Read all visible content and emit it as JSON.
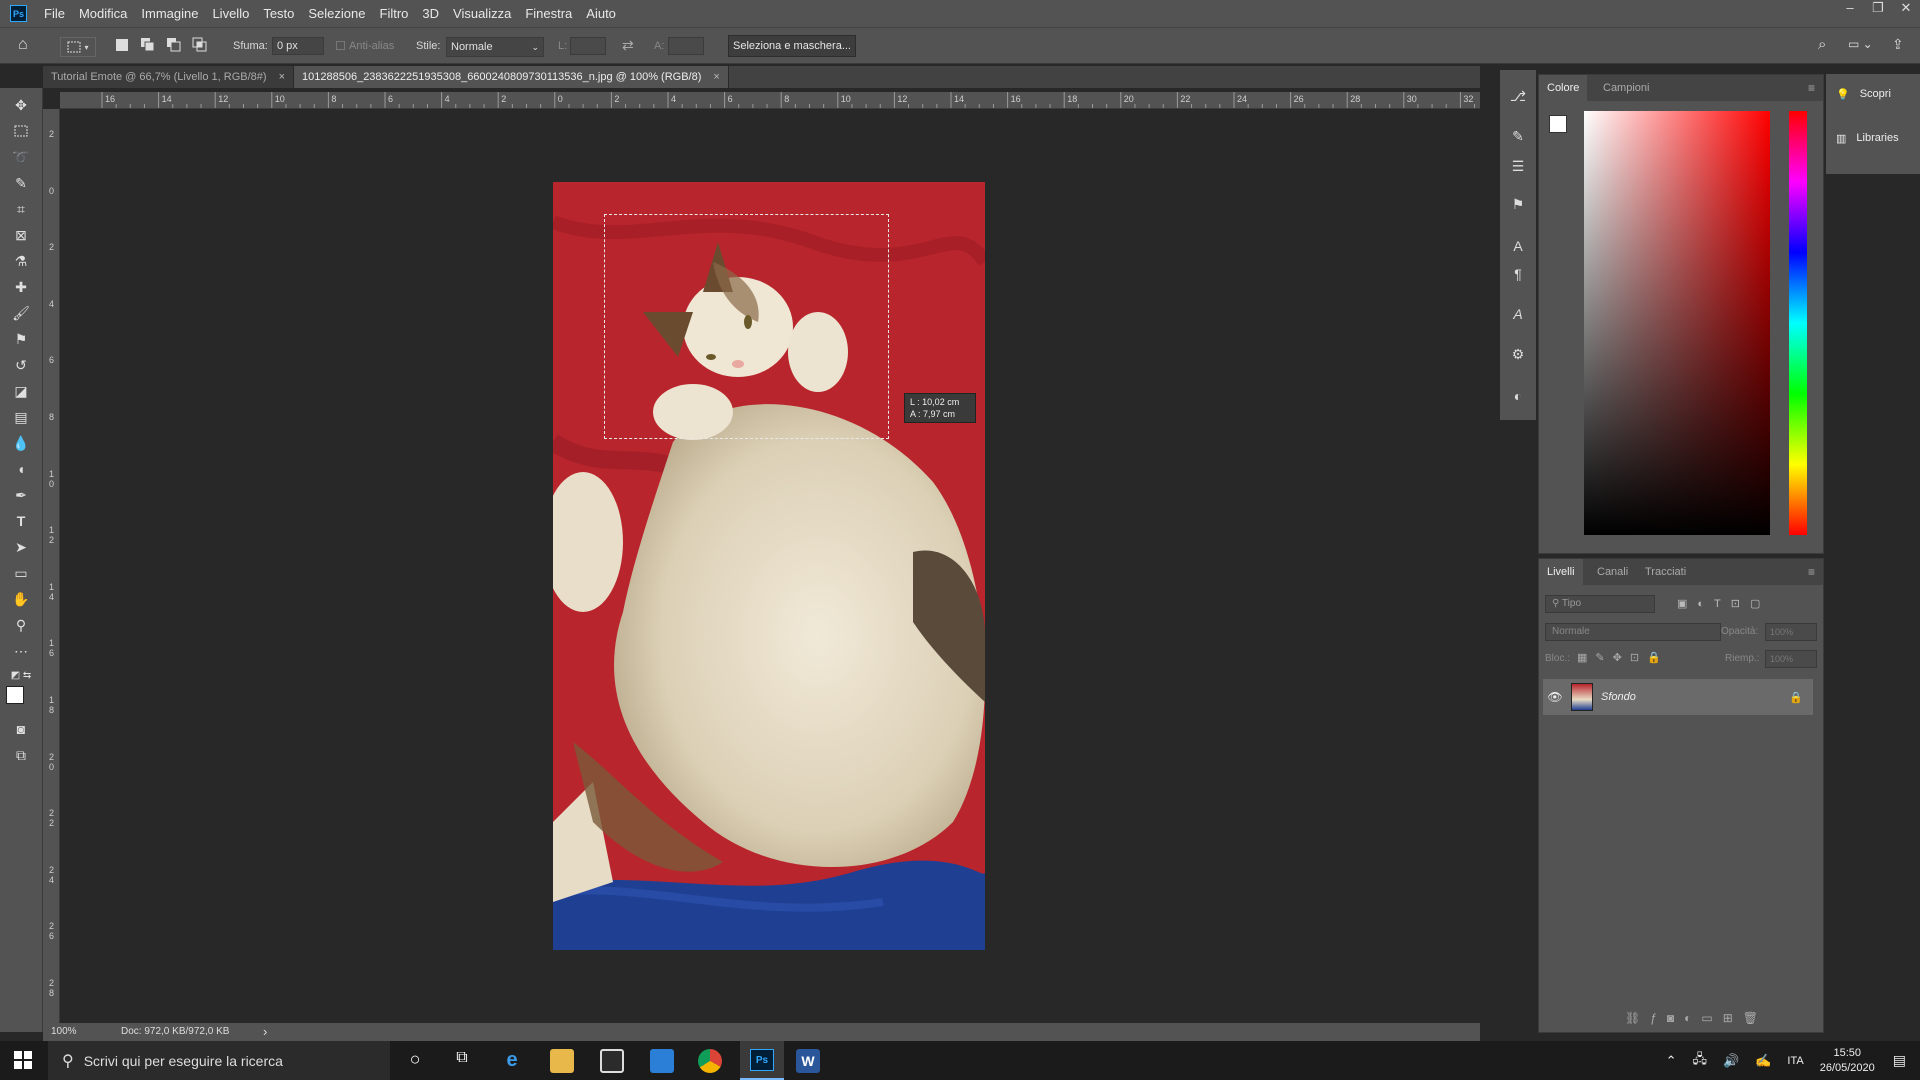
{
  "app": {
    "logo": "Ps"
  },
  "menu": [
    "File",
    "Modifica",
    "Immagine",
    "Livello",
    "Testo",
    "Selezione",
    "Filtro",
    "3D",
    "Visualizza",
    "Finestra",
    "Aiuto"
  ],
  "options": {
    "feather_label": "Sfuma:",
    "feather_value": "0 px",
    "antialias_label": "Anti-alias",
    "style_label": "Stile:",
    "style_value": "Normale",
    "width_label": "L:",
    "height_label": "A:",
    "select_mask_button": "Seleziona e maschera..."
  },
  "tabs": [
    {
      "label": "Tutorial Emote @ 66,7% (Livello 1, RGB/8#)",
      "close": "×"
    },
    {
      "label": "101288506_2383622251935308_6600240809730113536_n.jpg @ 100% (RGB/8)",
      "close": "×"
    }
  ],
  "ruler_top": [
    "16",
    "14",
    "12",
    "10",
    "8",
    "6",
    "4",
    "2",
    "0",
    "2",
    "4",
    "6",
    "8",
    "10",
    "12",
    "14",
    "16",
    "18",
    "20",
    "22",
    "24",
    "26",
    "28",
    "30",
    "32"
  ],
  "ruler_left": [
    "2",
    "0",
    "2",
    "4",
    "6",
    "8",
    "1 0",
    "1 2",
    "1 4",
    "1 6",
    "1 8",
    "2 0",
    "2 2",
    "2 4",
    "2 6",
    "2 8"
  ],
  "measure": {
    "width": "L :   10,02 cm",
    "height": "A :     7,97 cm"
  },
  "status": {
    "zoom": "100%",
    "doc": "Doc: 972,0 KB/972,0 KB",
    "arrow": "›"
  },
  "color_panel": {
    "tabs": [
      "Colore",
      "Campioni"
    ]
  },
  "layers_panel": {
    "tabs": [
      "Livelli",
      "Canali",
      "Tracciati"
    ],
    "filter_placeholder": "Tipo",
    "blend_mode": "Normale",
    "opacity_label": "Opacità:",
    "opacity_value": "100%",
    "lock_label": "Bloc.:",
    "fill_label": "Riemp.:",
    "fill_value": "100%",
    "layer_name": "Sfondo"
  },
  "right_panel": {
    "discover": "Scopri",
    "libraries": "Libraries"
  },
  "taskbar": {
    "search_placeholder": "Scrivi qui per eseguire la ricerca",
    "lang": "ITA",
    "time": "15:50",
    "date": "26/05/2020"
  },
  "colors": {
    "ps_blue": "#31a8ff",
    "panel": "#535353",
    "canvas_bg": "#282828"
  }
}
